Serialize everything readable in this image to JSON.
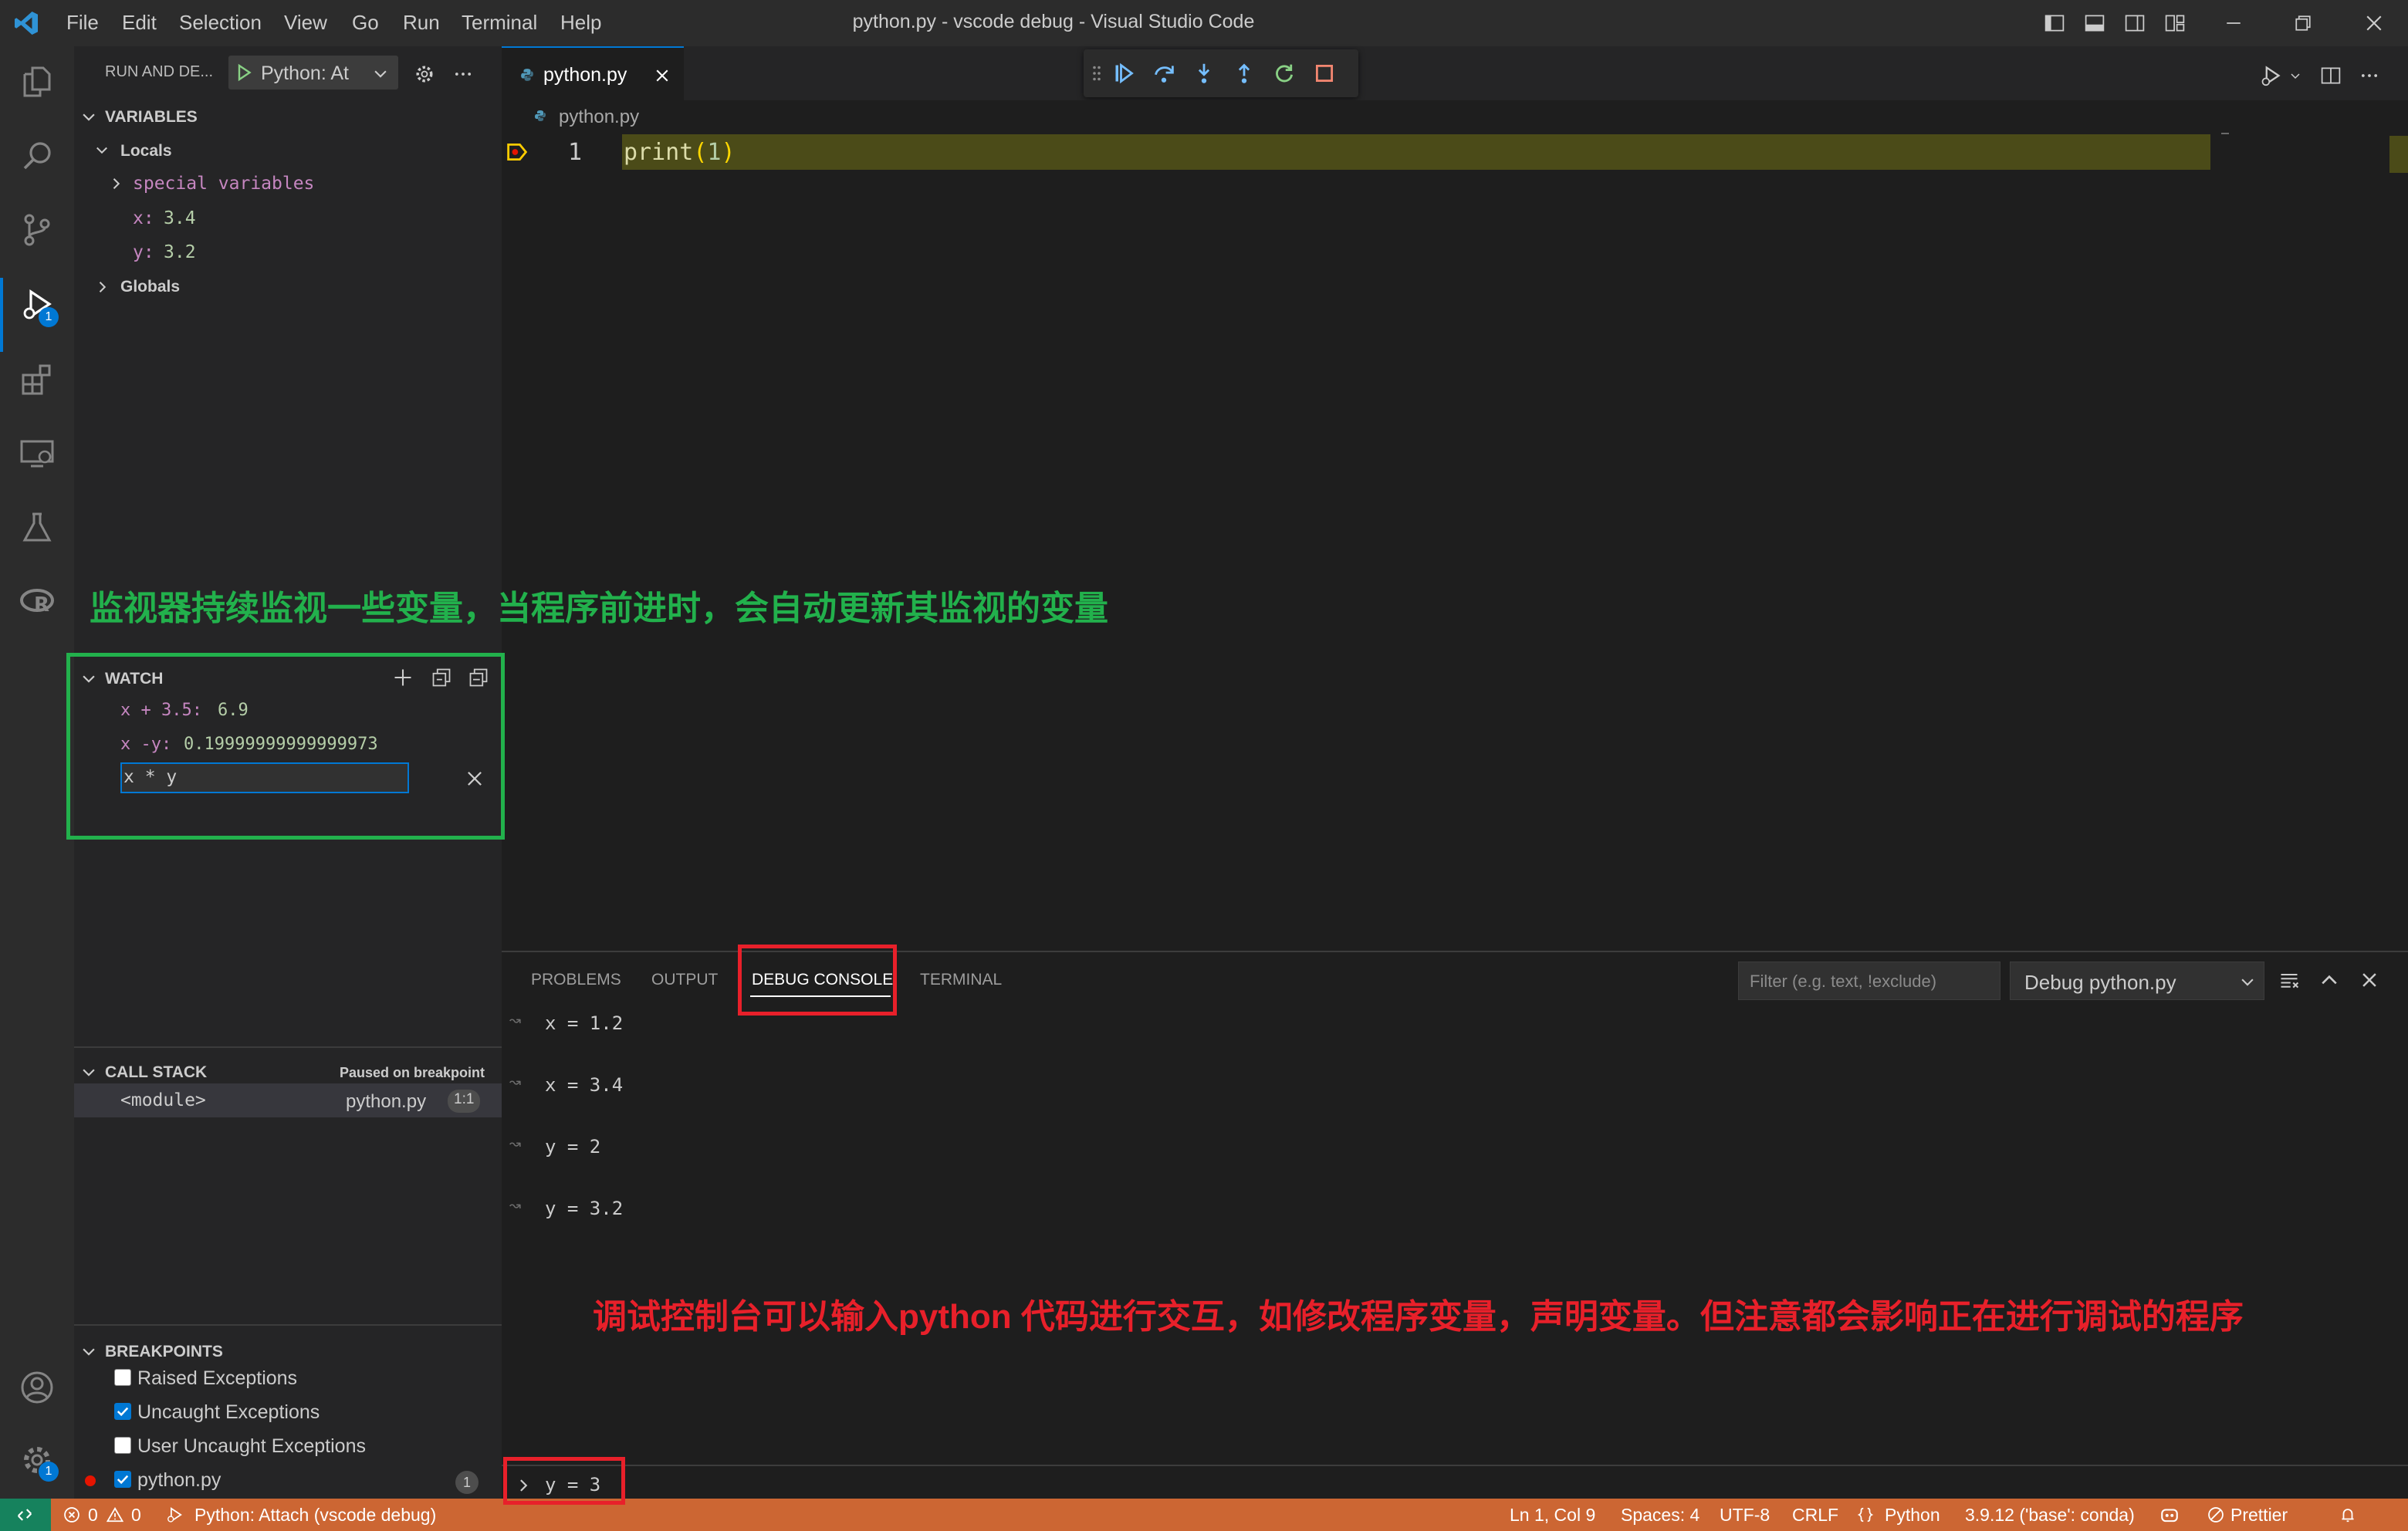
{
  "titlebar": {
    "menu": [
      "File",
      "Edit",
      "Selection",
      "View",
      "Go",
      "Run",
      "Terminal",
      "Help"
    ],
    "window_title": "python.py - vscode debug - Visual Studio Code"
  },
  "activity_bar": {
    "debug_badge": "1",
    "settings_badge": "1"
  },
  "sidebar": {
    "header_title": "RUN AND DE...",
    "config_name": "Python: At",
    "variables": {
      "title": "VARIABLES",
      "locals_label": "Locals",
      "special_label": "special variables",
      "x_name": "x:",
      "x_value": "3.4",
      "y_name": "y:",
      "y_value": "3.2",
      "globals_label": "Globals"
    },
    "watch": {
      "title": "WATCH",
      "items": [
        {
          "expr": "x + 3.5:",
          "value": "6.9"
        },
        {
          "expr": "x -y:",
          "value": "0.19999999999999973"
        }
      ],
      "input_value": "x * y"
    },
    "callstack": {
      "title": "CALL STACK",
      "status": "Paused on breakpoint",
      "frame": "<module>",
      "file": "python.py",
      "pos": "1:1"
    },
    "breakpoints": {
      "title": "BREAKPOINTS",
      "items": [
        {
          "label": "Raised Exceptions",
          "checked": false
        },
        {
          "label": "Uncaught Exceptions",
          "checked": true
        },
        {
          "label": "User Uncaught Exceptions",
          "checked": false
        },
        {
          "label": "python.py",
          "checked": true,
          "count": "1"
        }
      ]
    }
  },
  "editor": {
    "tab_label": "python.py",
    "breadcrumb": "python.py",
    "line_number": "1",
    "code_fn": "print",
    "code_paren_open": "(",
    "code_num": "1",
    "code_paren_close": ")"
  },
  "panel": {
    "tabs": [
      "PROBLEMS",
      "OUTPUT",
      "DEBUG CONSOLE",
      "TERMINAL"
    ],
    "active_tab": "DEBUG CONSOLE",
    "filter_placeholder": "Filter (e.g. text, !exclude)",
    "session": "Debug python.py",
    "console_lines": [
      "x = 1.2",
      "x = 3.4",
      "y = 2",
      "y = 3.2"
    ],
    "input_value": "y = 3"
  },
  "annotations": {
    "watch_note": "监视器持续监视一些变量，当程序前进时，会自动更新其监视的变量",
    "console_note": "调试控制台可以输入python 代码进行交互，如修改程序变量，声明变量。但注意都会影响正在进行调试的程序"
  },
  "statusbar": {
    "errors": "0",
    "warnings": "0",
    "debug_session": "Python: Attach (vscode debug)",
    "position": "Ln 1, Col 9",
    "spaces": "Spaces: 4",
    "encoding": "UTF-8",
    "eol": "CRLF",
    "language": "Python",
    "interpreter": "3.9.12 ('base': conda)",
    "prettier": "Prettier"
  },
  "colors": {
    "statusbar_bg": "#cc6633",
    "accent": "#0078d4",
    "annotation_green": "#22b14c",
    "annotation_red": "#e8202a",
    "current_line": "#4b4b18"
  }
}
